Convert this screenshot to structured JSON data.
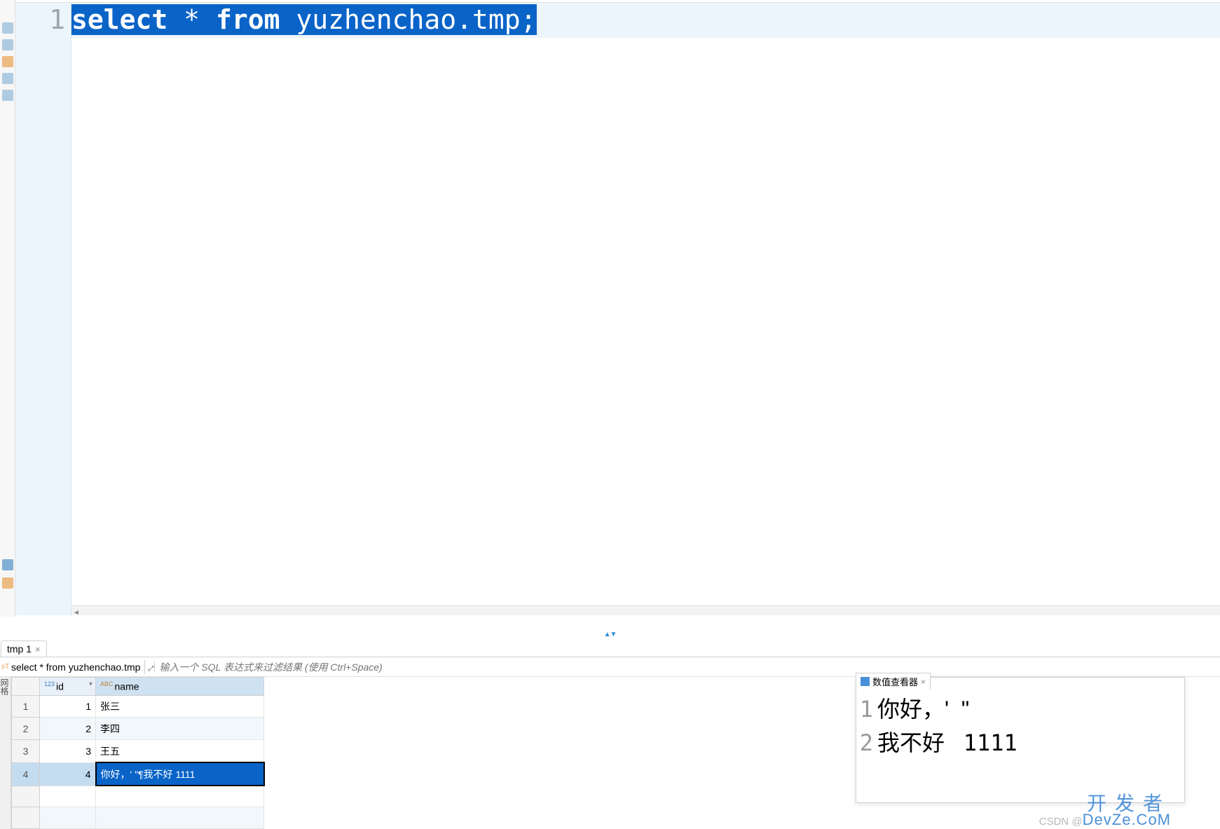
{
  "editor": {
    "lineNumber": "1",
    "sql": {
      "k_select": "select",
      "space1": " ",
      "star": "*",
      "space2": " ",
      "k_from": "from",
      "space3": " ",
      "table": "yuzhenchao.tmp;"
    }
  },
  "resultTab": {
    "label": "tmp 1",
    "close": "×"
  },
  "resultControl": {
    "queryText": "select * from yuzhenchao.tmp",
    "filterPlaceholder": "输入一个 SQL 表达式来过滤结果 (使用 Ctrl+Space)"
  },
  "grid": {
    "sideLabel": "网格",
    "columns": {
      "idType": "123",
      "id": "id",
      "nameType": "ABC",
      "name": "name"
    },
    "rows": [
      {
        "num": "1",
        "id": "1",
        "name": "张三"
      },
      {
        "num": "2",
        "id": "2",
        "name": "李四"
      },
      {
        "num": "3",
        "id": "3",
        "name": "王五"
      },
      {
        "num": "4",
        "id": "4",
        "name": "你好，' \"¶我不好 1111"
      }
    ]
  },
  "valueViewer": {
    "tabLabel": "数值查看器",
    "tabClose": "×",
    "lines": [
      {
        "num": "1",
        "text": "你好，'  \""
      },
      {
        "num": "2",
        "text": "我不好   ",
        "num2": "1111"
      }
    ]
  },
  "watermark": {
    "main": "开发者",
    "csdn": "CSDN @",
    "devze": "DevZe.CoM"
  }
}
